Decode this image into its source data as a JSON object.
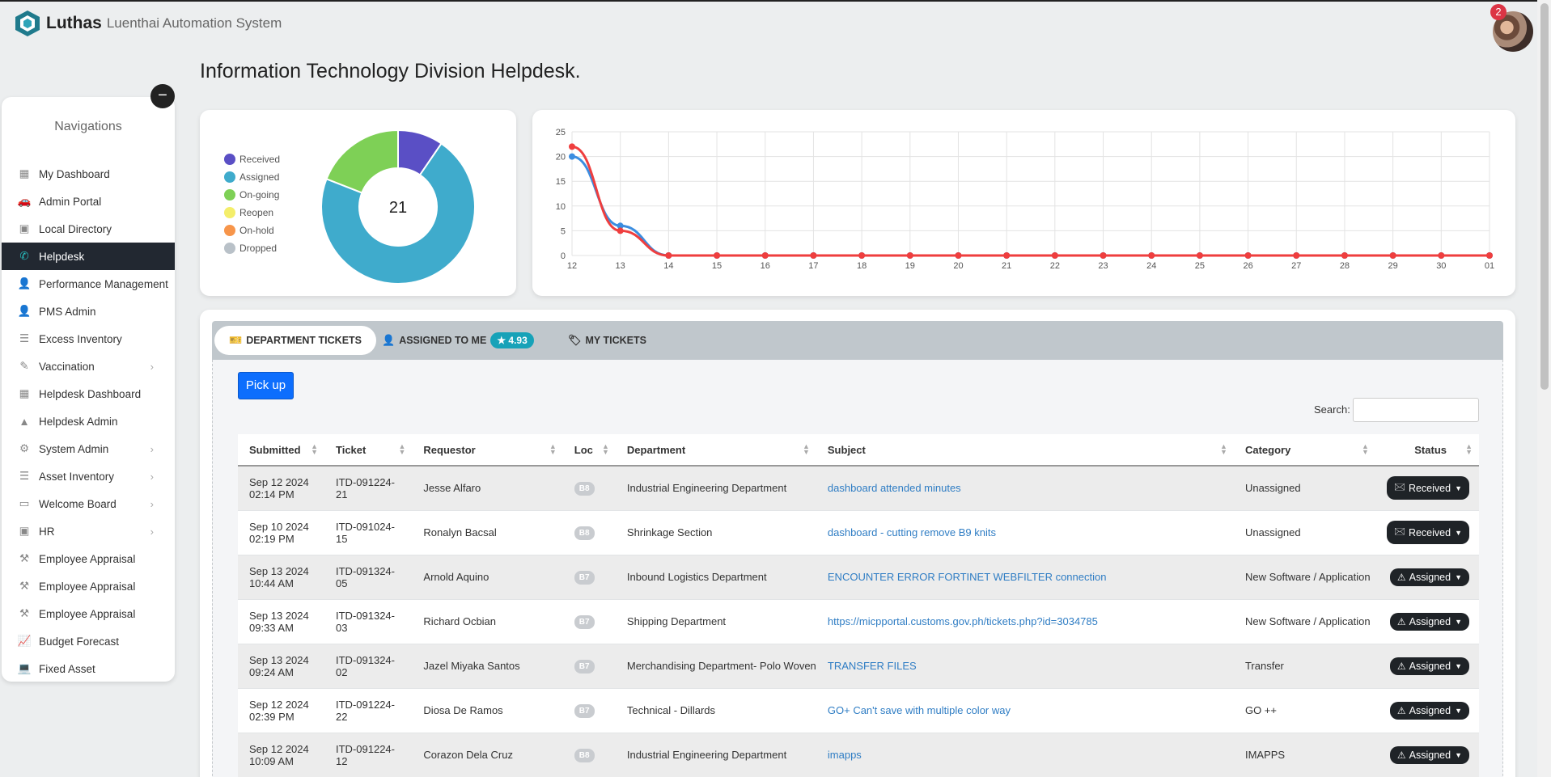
{
  "app": {
    "name": "Luthas",
    "subtitle": "Luenthai Automation System",
    "notification_count": "2"
  },
  "page_title": "Information Technology Division Helpdesk.",
  "sidebar": {
    "title": "Navigations",
    "items": [
      {
        "label": "My Dashboard",
        "icon": "grid-icon"
      },
      {
        "label": "Admin Portal",
        "icon": "car-icon"
      },
      {
        "label": "Local Directory",
        "icon": "contact-icon"
      },
      {
        "label": "Helpdesk",
        "icon": "phone-icon",
        "active": true
      },
      {
        "label": "Performance Management",
        "icon": "user-icon"
      },
      {
        "label": "PMS Admin",
        "icon": "user-icon"
      },
      {
        "label": "Excess Inventory",
        "icon": "list-icon"
      },
      {
        "label": "Vaccination",
        "icon": "syringe-icon",
        "has_sub": true
      },
      {
        "label": "Helpdesk Dashboard",
        "icon": "grid-icon"
      },
      {
        "label": "Helpdesk Admin",
        "icon": "warning-icon"
      },
      {
        "label": "System Admin",
        "icon": "user-gear-icon",
        "has_sub": true
      },
      {
        "label": "Asset Inventory",
        "icon": "list-icon",
        "has_sub": true
      },
      {
        "label": "Welcome Board",
        "icon": "monitor-icon",
        "has_sub": true
      },
      {
        "label": "HR",
        "icon": "contact-icon",
        "has_sub": true
      },
      {
        "label": "Employee Appraisal",
        "icon": "gavel-icon"
      },
      {
        "label": "Employee Appraisal",
        "icon": "gavel-icon"
      },
      {
        "label": "Employee Appraisal",
        "icon": "gavel-icon"
      },
      {
        "label": "Budget Forecast",
        "icon": "chart-line-icon"
      },
      {
        "label": "Fixed Asset",
        "icon": "laptop-icon"
      }
    ]
  },
  "donut": {
    "total": "21",
    "legend": [
      {
        "label": "Received",
        "color": "#5a4fc5"
      },
      {
        "label": "Assigned",
        "color": "#3fabcc"
      },
      {
        "label": "On-going",
        "color": "#7ed056"
      },
      {
        "label": "Reopen",
        "color": "#f4ee6a"
      },
      {
        "label": "On-hold",
        "color": "#f7954a"
      },
      {
        "label": "Dropped",
        "color": "#b9c1c8"
      }
    ]
  },
  "chart_data": [
    {
      "type": "pie",
      "categories": [
        "Received",
        "Assigned",
        "On-going",
        "Reopen",
        "On-hold",
        "Dropped"
      ],
      "values": [
        2,
        15,
        4,
        0,
        0,
        0
      ],
      "center_label": "21"
    },
    {
      "type": "line",
      "x": [
        "12",
        "13",
        "14",
        "15",
        "16",
        "17",
        "18",
        "19",
        "20",
        "21",
        "22",
        "23",
        "24",
        "25",
        "26",
        "27",
        "28",
        "29",
        "30",
        "01"
      ],
      "series": [
        {
          "color": "#3b8de0",
          "values": [
            20,
            6,
            0,
            0,
            0,
            0,
            0,
            0,
            0,
            0,
            0,
            0,
            0,
            0,
            0,
            0,
            0,
            0,
            0,
            0
          ]
        },
        {
          "color": "#ef3e3e",
          "values": [
            22,
            5,
            0,
            0,
            0,
            0,
            0,
            0,
            0,
            0,
            0,
            0,
            0,
            0,
            0,
            0,
            0,
            0,
            0,
            0
          ]
        }
      ],
      "ylim": [
        0,
        25
      ],
      "yticks": [
        "0",
        "5",
        "10",
        "15",
        "20",
        "25"
      ],
      "grid": true
    }
  ],
  "tabs": {
    "department": "DEPARTMENT TICKETS",
    "assigned": "ASSIGNED TO ME",
    "rating": "4.93",
    "mine": "MY TICKETS"
  },
  "toolbar": {
    "pickup_label": "Pick up",
    "search_label": "Search:"
  },
  "table": {
    "headers": [
      "Submitted",
      "Ticket",
      "Requestor",
      "Loc",
      "Department",
      "Subject",
      "Category",
      "Status"
    ],
    "rows": [
      {
        "submitted_date": "Sep 12 2024",
        "submitted_time": "02:14 PM",
        "ticket1": "ITD-091224-",
        "ticket2": "21",
        "requestor": "Jesse Alfaro",
        "loc": "B8",
        "department": "Industrial Engineering Department",
        "subject": "dashboard attended minutes",
        "category": "Unassigned",
        "status": "Received"
      },
      {
        "submitted_date": "Sep 10 2024",
        "submitted_time": "02:19 PM",
        "ticket1": "ITD-091024-",
        "ticket2": "15",
        "requestor": "Ronalyn Bacsal",
        "loc": "B8",
        "department": "Shrinkage Section",
        "subject": "dashboard - cutting remove B9 knits",
        "category": "Unassigned",
        "status": "Received"
      },
      {
        "submitted_date": "Sep 13 2024",
        "submitted_time": "10:44 AM",
        "ticket1": "ITD-091324-",
        "ticket2": "05",
        "requestor": "Arnold Aquino",
        "loc": "B7",
        "department": "Inbound Logistics Department",
        "subject": "ENCOUNTER ERROR FORTINET WEBFILTER connection",
        "category": "New Software / Application",
        "status": "Assigned"
      },
      {
        "submitted_date": "Sep 13 2024",
        "submitted_time": "09:33 AM",
        "ticket1": "ITD-091324-",
        "ticket2": "03",
        "requestor": "Richard Ocbian",
        "loc": "B7",
        "department": "Shipping Department",
        "subject": "https://micpportal.customs.gov.ph/tickets.php?id=3034785",
        "category": "New Software / Application",
        "status": "Assigned"
      },
      {
        "submitted_date": "Sep 13 2024",
        "submitted_time": "09:24 AM",
        "ticket1": "ITD-091324-",
        "ticket2": "02",
        "requestor": "Jazel Miyaka Santos",
        "loc": "B7",
        "department": "Merchandising Department- Polo Woven",
        "subject": "TRANSFER FILES",
        "category": "Transfer",
        "status": "Assigned"
      },
      {
        "submitted_date": "Sep 12 2024",
        "submitted_time": "02:39 PM",
        "ticket1": "ITD-091224-",
        "ticket2": "22",
        "requestor": "Diosa De Ramos",
        "loc": "B7",
        "department": "Technical - Dillards",
        "subject": "GO+ Can't save with multiple color way",
        "category": "GO ++",
        "status": "Assigned"
      },
      {
        "submitted_date": "Sep 12 2024",
        "submitted_time": "10:09 AM",
        "ticket1": "ITD-091224-",
        "ticket2": "12",
        "requestor": "Corazon Dela Cruz",
        "loc": "B8",
        "department": "Industrial Engineering Department",
        "subject": "imapps",
        "category": "IMAPPS",
        "status": "Assigned"
      }
    ]
  }
}
